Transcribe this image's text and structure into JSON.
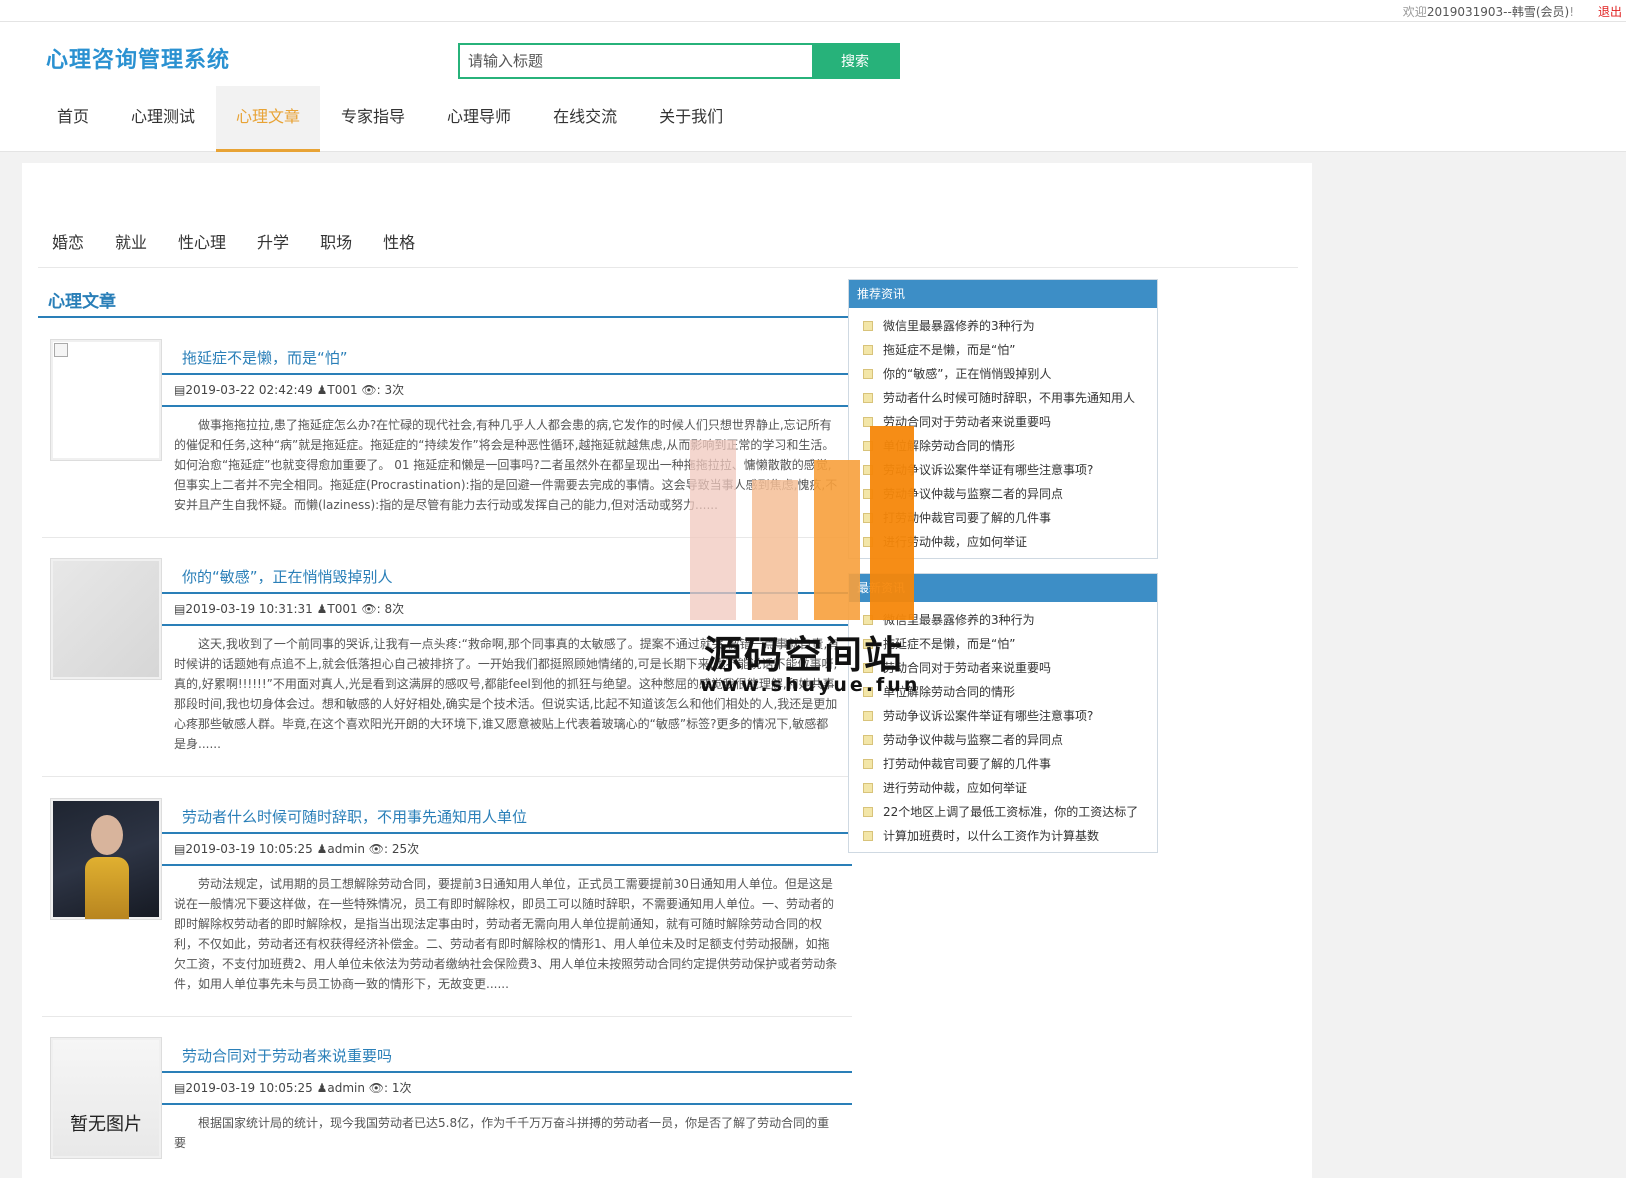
{
  "topbar": {
    "welcome_prefix": "欢迎",
    "user": "2019031903--韩雪(会员)",
    "separator": "!",
    "logout": "退出"
  },
  "header": {
    "logo": "心理咨询管理系统",
    "search_placeholder": "请输入标题",
    "search_button": "搜索"
  },
  "nav": {
    "items": [
      "首页",
      "心理测试",
      "心理文章",
      "专家指导",
      "心理导师",
      "在线交流",
      "关于我们"
    ],
    "active_index": 2
  },
  "categories": [
    "婚恋",
    "就业",
    "性心理",
    "升学",
    "职场",
    "性格"
  ],
  "section_title": "心理文章",
  "articles": [
    {
      "title": "拖延症不是懒，而是“怕”",
      "meta": "2019-03-22 02:42:49 ♟T001 👁: 3次",
      "body": "做事拖拖拉拉,患了拖延症怎么办?在忙碌的现代社会,有种几乎人人都会患的病,它发作的时候人们只想世界静止,忘记所有的催促和任务,这种“病”就是拖延症。拖延症的“持续发作”将会是种恶性循环,越拖延就越焦虑,从而影响到正常的学习和生活。如何治愈“拖延症”也就变得愈加重要了。 01 拖延症和懒是一回事吗?二者虽然外在都呈现出一种拖拖拉拉、慵懒散散的感觉,但事实上二者并不完全相同。拖延症(Procrastination):指的是回避一件需要去完成的事情。这会导致当事人感到焦虑,愧疚,不安并且产生自我怀疑。而懒(laziness):指的是尽管有能力去行动或发挥自己的能力,但对活动或努力......"
    },
    {
      "title": "你的“敏感”，正在悄悄毁掉别人",
      "meta": "2019-03-19 10:31:31 ♟T001 👁: 8次",
      "body": "这天,我收到了一个前同事的哭诉,让我有一点头疼:“救命啊,那个同事真的太敏感了。提案不通过就哭,做错一点事就自责,有时候讲的话题她有点追不上,就会低落担心自己被排挤了。一开始我们都挺照顾她情绪的,可是长期下来,也不能说话不能做事呀,真的,好累啊!!!!!!”不用面对真人,光是看到这满屏的感叹号,都能feel到他的抓狂与绝望。这种憋屈的感觉我很能理解,和她共事那段时间,我也切身体会过。想和敏感的人好好相处,确实是个技术活。但说实话,比起不知道该怎么和他们相处的人,我还是更加心疼那些敏感人群。毕竟,在这个喜欢阳光开朗的大环境下,谁又愿意被贴上代表着玻璃心的“敏感”标签?更多的情况下,敏感都是身......"
    },
    {
      "title": "劳动者什么时候可随时辞职，不用事先通知用人单位",
      "meta": "2019-03-19 10:05:25 ♟admin 👁: 25次",
      "body": "劳动法规定，试用期的员工想解除劳动合同，要提前3日通知用人单位，正式员工需要提前30日通知用人单位。但是这是说在一般情况下要这样做，在一些特殊情况，员工有即时解除权，即员工可以随时辞职，不需要通知用人单位。一、劳动者的即时解除权劳动者的即时解除权，是指当出现法定事由时，劳动者无需向用人单位提前通知，就有可随时解除劳动合同的权利，不仅如此，劳动者还有权获得经济补偿金。二、劳动者有即时解除权的情形1、用人单位未及时足额支付劳动报酬，如拖欠工资，不支付加班费2、用人单位未依法为劳动者缴纳社会保险费3、用人单位未按照劳动合同约定提供劳动保护或者劳动条件，如用人单位事先未与员工协商一致的情形下，无故变更......"
    },
    {
      "title": "劳动合同对于劳动者来说重要吗",
      "meta": "2019-03-19 10:05:25 ♟admin 👁: 1次",
      "body": "根据国家统计局的统计，现今我国劳动者已达5.8亿，作为千千万万奋斗拼搏的劳动者一员，你是否了解了劳动合同的重要",
      "thumb_text": "暂无图片"
    }
  ],
  "sidebar": {
    "recommended": {
      "title": "推荐资讯",
      "items": [
        "微信里最暴露修养的3种行为",
        "拖延症不是懒，而是“怕”",
        "你的“敏感”，正在悄悄毁掉别人",
        "劳动者什么时候可随时辞职，不用事先通知用人",
        "劳动合同对于劳动者来说重要吗",
        "单位解除劳动合同的情形",
        "劳动争议诉讼案件举证有哪些注意事项?",
        "劳动争议仲裁与监察二者的异同点",
        "打劳动仲裁官司要了解的几件事",
        "进行劳动仲裁，应如何举证"
      ]
    },
    "latest": {
      "title": "最新资讯",
      "items": [
        "微信里最暴露修养的3种行为",
        "拖延症不是懒，而是“怕”",
        "劳动合同对于劳动者来说重要吗",
        "单位解除劳动合同的情形",
        "劳动争议诉讼案件举证有哪些注意事项?",
        "劳动争议仲裁与监察二者的异同点",
        "打劳动仲裁官司要了解的几件事",
        "进行劳动仲裁，应如何举证",
        "22个地区上调了最低工资标准，你的工资达标了",
        "计算加班费时，以什么工资作为计算基数"
      ]
    }
  },
  "watermark": {
    "name": "源码空间站",
    "url": "www.shuyue.fun"
  },
  "colors": {
    "brand_blue": "#2a7fb8",
    "search_green": "#27b27a",
    "nav_active": "#e8a335",
    "sidebar_head": "#3d8ec6"
  }
}
